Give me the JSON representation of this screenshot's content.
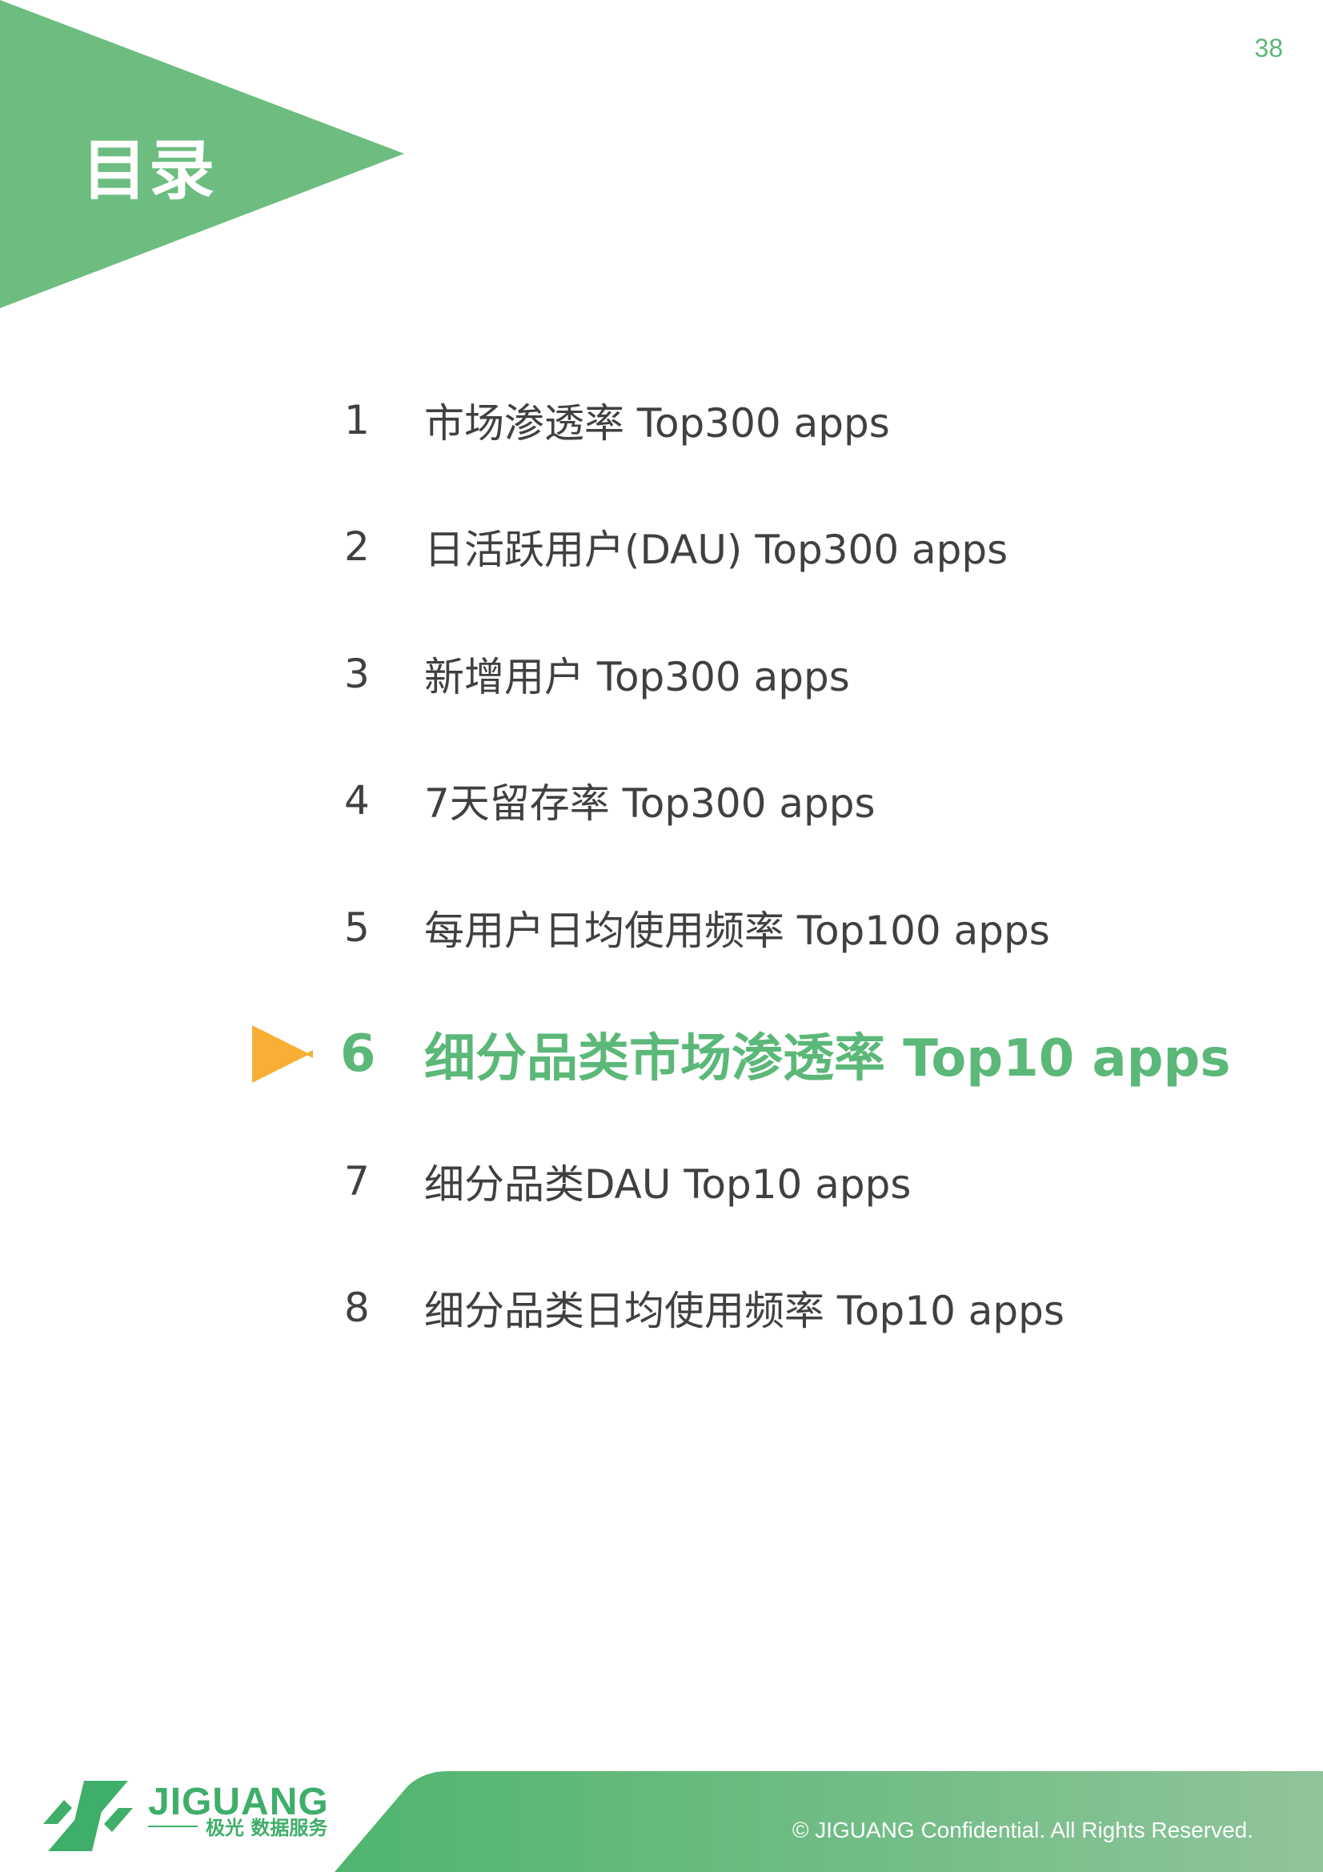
{
  "page_number": "38",
  "title": "目录",
  "toc": {
    "items": [
      {
        "num": "1",
        "label": "市场渗透率 Top300 apps",
        "active": false
      },
      {
        "num": "2",
        "label": "日活跃用户(DAU) Top300 apps",
        "active": false
      },
      {
        "num": "3",
        "label": "新增用户 Top300 apps",
        "active": false
      },
      {
        "num": "4",
        "label": "7天留存率 Top300 apps",
        "active": false
      },
      {
        "num": "5",
        "label": "每用户日均使用频率 Top100 apps",
        "active": false
      },
      {
        "num": "6",
        "label": "细分品类市场渗透率 Top10 apps",
        "active": true
      },
      {
        "num": "7",
        "label": "细分品类DAU Top10 apps",
        "active": false
      },
      {
        "num": "8",
        "label": "细分品类日均使用频率 Top10 apps",
        "active": false
      }
    ]
  },
  "footer": {
    "brand": "JIGUANG",
    "brand_sub": "极光 数据服务",
    "copyright": "© JIGUANG Confidential. All Rights Reserved."
  },
  "colors": {
    "accent_green": "#5bb878",
    "marker_orange": "#f7b035",
    "text_gray": "#404040"
  }
}
